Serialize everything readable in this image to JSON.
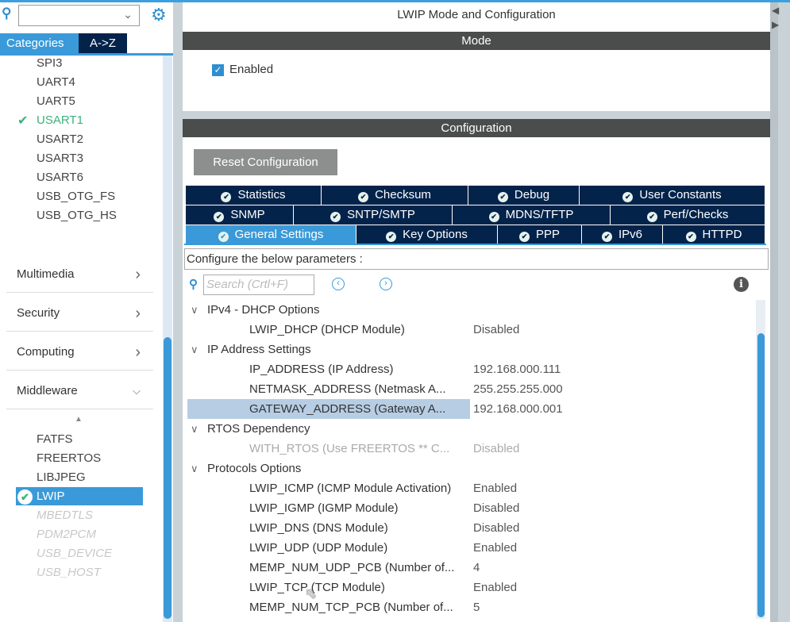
{
  "left": {
    "search_value": "",
    "tabs": [
      "Categories",
      "A->Z"
    ],
    "connectivity_items": [
      {
        "label": "SPI3",
        "state": "normal"
      },
      {
        "label": "UART4",
        "state": "normal"
      },
      {
        "label": "UART5",
        "state": "normal"
      },
      {
        "label": "USART1",
        "state": "enabled"
      },
      {
        "label": "USART2",
        "state": "normal"
      },
      {
        "label": "USART3",
        "state": "normal"
      },
      {
        "label": "USART6",
        "state": "normal"
      },
      {
        "label": "USB_OTG_FS",
        "state": "normal"
      },
      {
        "label": "USB_OTG_HS",
        "state": "normal"
      }
    ],
    "categories": [
      "Multimedia",
      "Security",
      "Computing",
      "Middleware"
    ],
    "middleware_items": [
      {
        "label": "FATFS",
        "state": "normal"
      },
      {
        "label": "FREERTOS",
        "state": "normal"
      },
      {
        "label": "LIBJPEG",
        "state": "normal"
      },
      {
        "label": "LWIP",
        "state": "selected"
      },
      {
        "label": "MBEDTLS",
        "state": "disabled"
      },
      {
        "label": "PDM2PCM",
        "state": "disabled"
      },
      {
        "label": "USB_DEVICE",
        "state": "disabled"
      },
      {
        "label": "USB_HOST",
        "state": "disabled"
      }
    ]
  },
  "main": {
    "title": "LWIP Mode and Configuration",
    "mode_header": "Mode",
    "enabled_label": "Enabled",
    "enabled_checked": true,
    "config_header": "Configuration",
    "reset_label": "Reset Configuration",
    "tabs_row1": [
      "Statistics",
      "Checksum",
      "Debug",
      "User Constants"
    ],
    "tabs_row2": [
      "SNMP",
      "SNTP/SMTP",
      "MDNS/TFTP",
      "Perf/Checks"
    ],
    "tabs_row3": [
      "General Settings",
      "Key Options",
      "PPP",
      "IPv6",
      "HTTPD"
    ],
    "active_tab": "General Settings",
    "configure_text": "Configure the below parameters :",
    "search_placeholder": "Search (Crtl+F)",
    "rows": [
      {
        "type": "group",
        "label": "IPv4 - DHCP Options"
      },
      {
        "type": "param",
        "name": "LWIP_DHCP (DHCP Module)",
        "value": "Disabled"
      },
      {
        "type": "group",
        "label": "IP Address Settings"
      },
      {
        "type": "param",
        "name": "IP_ADDRESS (IP Address)",
        "value": "192.168.000.111"
      },
      {
        "type": "param",
        "name": "NETMASK_ADDRESS (Netmask A...",
        "value": "255.255.255.000"
      },
      {
        "type": "param",
        "name": "GATEWAY_ADDRESS (Gateway A...",
        "value": "192.168.000.001",
        "selected": true
      },
      {
        "type": "group",
        "label": "RTOS Dependency"
      },
      {
        "type": "param",
        "name": "WITH_RTOS (Use FREERTOS ** C...",
        "value": "Disabled",
        "disabled": true
      },
      {
        "type": "group",
        "label": "Protocols Options"
      },
      {
        "type": "param",
        "name": "LWIP_ICMP (ICMP Module Activation)",
        "value": "Enabled"
      },
      {
        "type": "param",
        "name": "LWIP_IGMP (IGMP Module)",
        "value": "Disabled"
      },
      {
        "type": "param",
        "name": "LWIP_DNS (DNS Module)",
        "value": "Disabled"
      },
      {
        "type": "param",
        "name": "LWIP_UDP (UDP Module)",
        "value": "Enabled"
      },
      {
        "type": "param",
        "name": "MEMP_NUM_UDP_PCB (Number of...",
        "value": "4"
      },
      {
        "type": "param",
        "name": "LWIP_TCP (TCP Module)",
        "value": "Enabled"
      },
      {
        "type": "param",
        "name": "MEMP_NUM_TCP_PCB (Number of...",
        "value": "5"
      }
    ]
  },
  "colors": {
    "accent": "#3a9ad9",
    "tab_dark": "#03234b",
    "header": "#4a4d4c",
    "ok": "#3bb37b"
  }
}
